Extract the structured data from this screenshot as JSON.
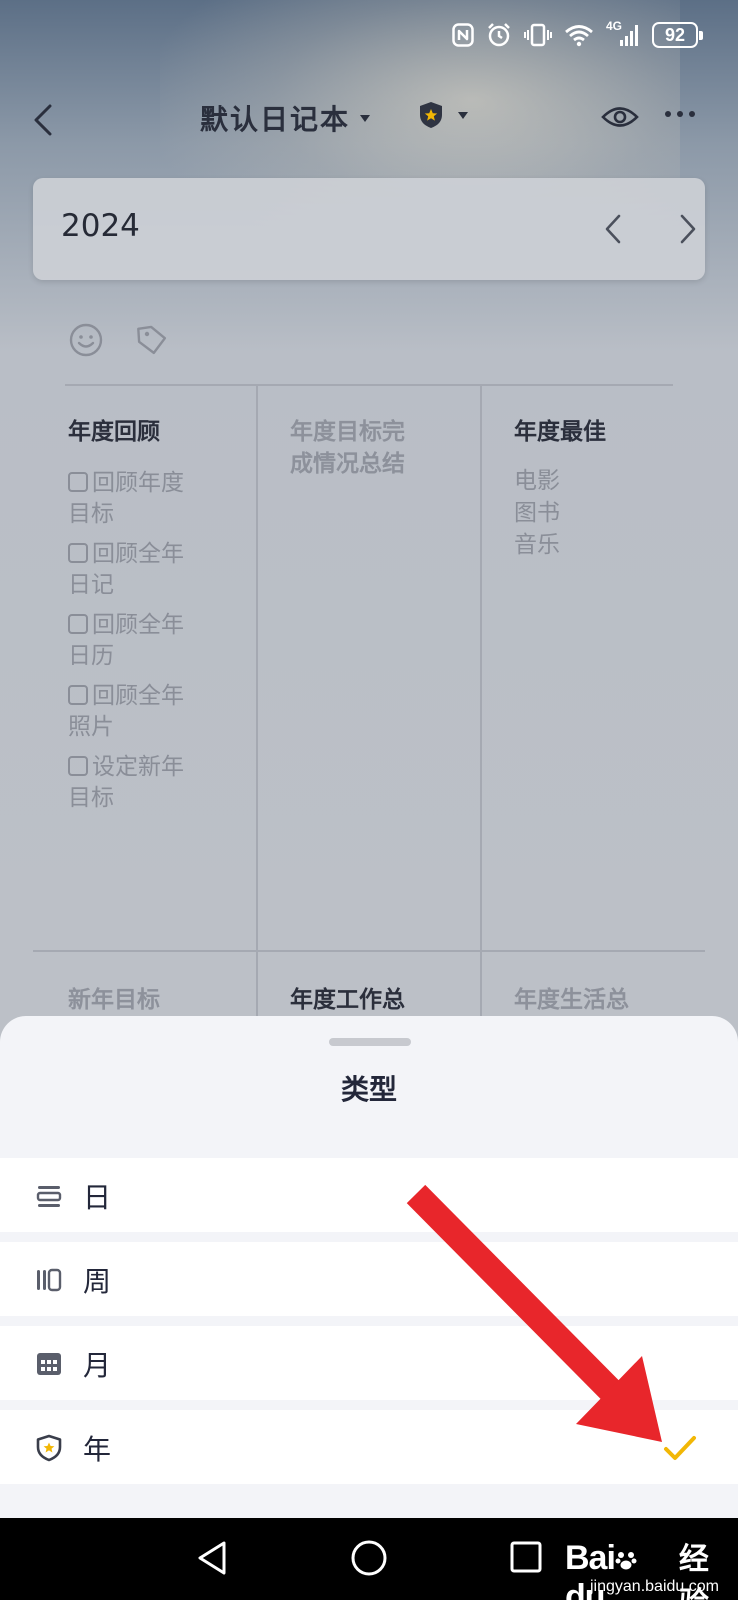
{
  "status_bar": {
    "icons": [
      "nfc-icon",
      "alarm-icon",
      "vibrate-icon",
      "wifi-icon",
      "signal-4g-icon",
      "battery-icon"
    ],
    "network_label": "4G",
    "battery_level": "92"
  },
  "header": {
    "back_icon": "chevron-left-icon",
    "title": "默认日记本",
    "title_dropdown_icon": "caret-down-icon",
    "type_badge_icon": "shield-star-icon",
    "type_dropdown_icon": "caret-down-icon",
    "preview_icon": "eye-icon",
    "more_icon": "more-dots-icon"
  },
  "year_selector": {
    "year": "2024",
    "prev_icon": "chevron-left-icon",
    "next_icon": "chevron-right-icon"
  },
  "toolbar": {
    "mood_icon": "smiley-icon",
    "tag_icon": "tag-icon"
  },
  "template": {
    "annual_review": {
      "title": "年度回顾",
      "items": [
        {
          "line1": "回顾年度",
          "line2": "目标"
        },
        {
          "line1": "回顾全年",
          "line2": "日记"
        },
        {
          "line1": "回顾全年",
          "line2": "日历"
        },
        {
          "line1": "回顾全年",
          "line2": "照片"
        },
        {
          "line1": "设定新年",
          "line2": "目标"
        }
      ]
    },
    "goal_summary": {
      "title_line1": "年度目标完",
      "title_line2": "成情况总结"
    },
    "annual_best": {
      "title": "年度最佳",
      "items": [
        "电影",
        "图书",
        "音乐"
      ]
    },
    "new_year_goals": {
      "title": "新年目标"
    },
    "work_summary": {
      "title": "年度工作总"
    },
    "life_summary": {
      "title": "年度生活总"
    }
  },
  "sheet": {
    "title": "类型",
    "options": [
      {
        "label": "日",
        "icon": "day-list-icon",
        "selected": false
      },
      {
        "label": "周",
        "icon": "week-bars-icon",
        "selected": false
      },
      {
        "label": "月",
        "icon": "calendar-grid-icon",
        "selected": false
      },
      {
        "label": "年",
        "icon": "shield-star-icon",
        "selected": true
      }
    ],
    "check_color": "#f2b705"
  },
  "annotation": {
    "arrow_color": "#e8262b"
  },
  "nav_bar": {
    "back_icon": "triangle-back-icon",
    "home_icon": "circle-home-icon",
    "recent_icon": "square-recent-icon"
  },
  "watermark": {
    "logo": "Bai",
    "logo_suffix": "du",
    "text": "经验",
    "url": "jingyan.baidu.com"
  }
}
